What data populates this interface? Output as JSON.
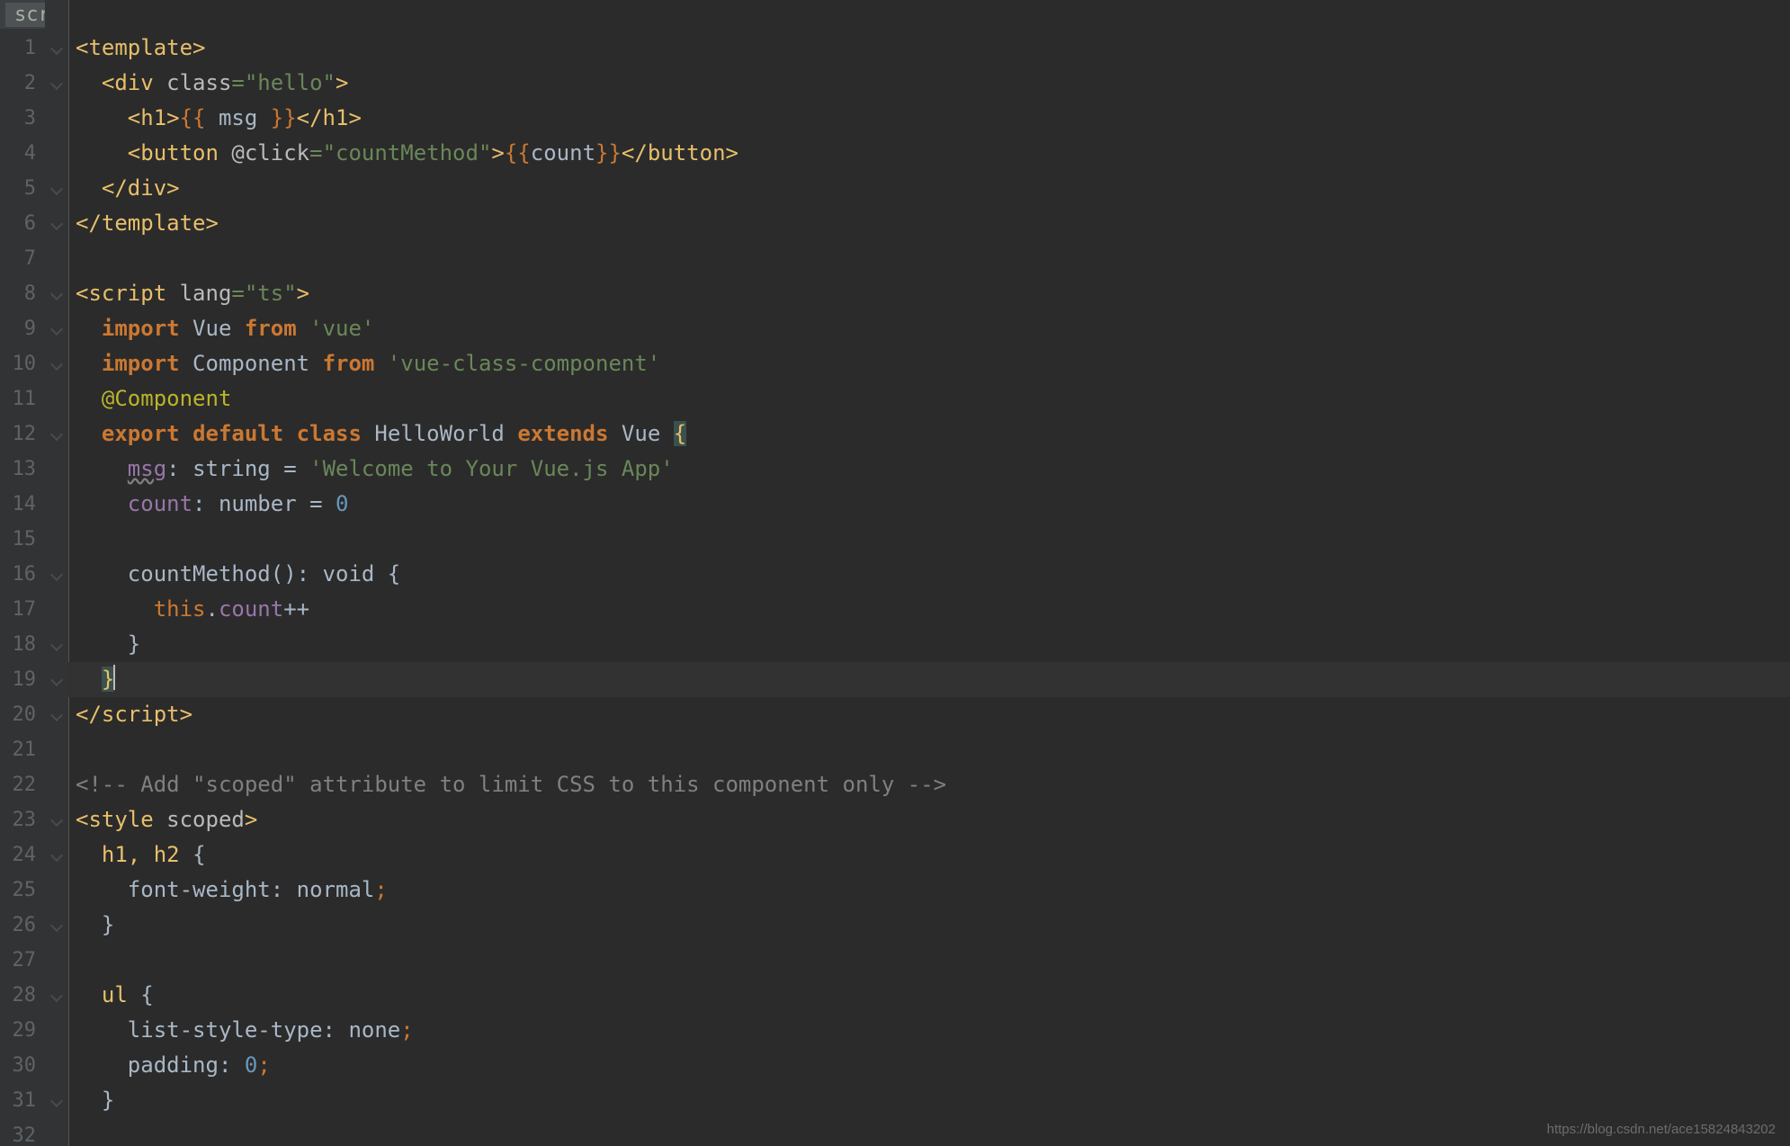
{
  "breadcrumb": {
    "label": "script"
  },
  "gutter": {
    "lines": [
      "1",
      "2",
      "3",
      "4",
      "5",
      "6",
      "7",
      "8",
      "9",
      "10",
      "11",
      "12",
      "13",
      "14",
      "15",
      "16",
      "17",
      "18",
      "19",
      "20",
      "21",
      "22",
      "23",
      "24",
      "25",
      "26",
      "27",
      "28",
      "29",
      "30",
      "31",
      "32"
    ]
  },
  "code": {
    "l1": {
      "tag_open": "<template>"
    },
    "l2": {
      "tag_open": "<div",
      "attr": "class",
      "eq": "=",
      "val": "\"hello\"",
      "close": ">"
    },
    "l3": {
      "open": "<h1>",
      "must_o": "{{",
      "var": " msg ",
      "must_c": "}}",
      "close": "</h1>"
    },
    "l4": {
      "open": "<button",
      "attr": "@click",
      "eq": "=",
      "val": "\"countMethod\"",
      "gt": ">",
      "must_o": "{{",
      "var": "count",
      "must_c": "}}",
      "close": "</button>"
    },
    "l5": {
      "close": "</div>"
    },
    "l6": {
      "close": "</template>"
    },
    "l8": {
      "open": "<script",
      "attr": "lang",
      "eq": "=",
      "val": "\"ts\"",
      "gt": ">"
    },
    "l9": {
      "imp": "import",
      "name": " Vue ",
      "from": "from",
      "str": " 'vue'"
    },
    "l10": {
      "imp": "import",
      "name": " Component ",
      "from": "from",
      "str": " 'vue-class-component'"
    },
    "l11": {
      "deco": "@Component"
    },
    "l12": {
      "exp": "export",
      "def": "default",
      "cls": "class",
      "name": " HelloWorld ",
      "ext": "extends",
      "sup": " Vue ",
      "brace": "{"
    },
    "l13": {
      "prop": "msg",
      "colon": ": ",
      "type": "string",
      "eq": " = ",
      "str": "'Welcome to Your Vue.js App'"
    },
    "l14": {
      "prop": "count",
      "colon": ": ",
      "type": "number",
      "eq": " = ",
      "num": "0"
    },
    "l16": {
      "name": "countMethod",
      "paren": "(): ",
      "type": "void",
      "brace": " {"
    },
    "l17": {
      "this": "this",
      "dot": ".",
      "prop": "count",
      "op": "++"
    },
    "l18": {
      "brace": "}"
    },
    "l19": {
      "brace": "}"
    },
    "l20": {
      "close_script_open": "</",
      "close_script_name": "script",
      "close_script_end": ">"
    },
    "l22": {
      "comment": "<!-- Add \"scoped\" attribute to limit CSS to this component only -->"
    },
    "l23": {
      "open": "<style",
      "attr": "scoped",
      "gt": ">"
    },
    "l24": {
      "sel": "h1, h2 ",
      "brace": "{"
    },
    "l25": {
      "prop": "font-weight",
      "colon": ": ",
      "val": "normal",
      "semi": ";"
    },
    "l26": {
      "brace": "}"
    },
    "l28": {
      "sel": "ul ",
      "brace": "{"
    },
    "l29": {
      "prop": "list-style-type",
      "colon": ": ",
      "val": "none",
      "semi": ";"
    },
    "l30": {
      "prop": "padding",
      "colon": ": ",
      "val": "0",
      "semi": ";"
    },
    "l31": {
      "brace": "}"
    }
  },
  "watermark": "https://blog.csdn.net/ace15824843202"
}
